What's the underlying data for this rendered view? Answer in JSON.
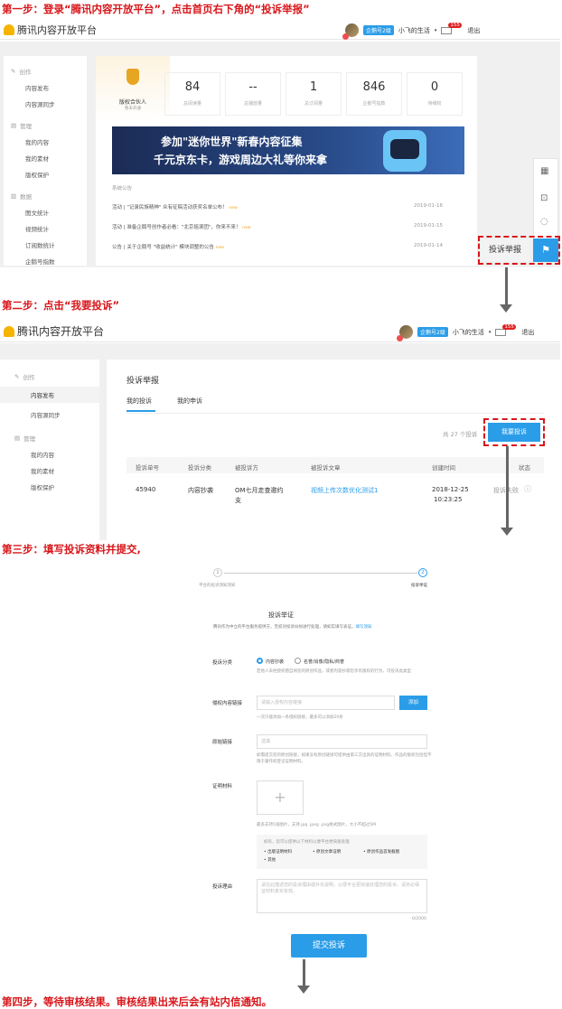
{
  "steps": {
    "step1": "第一步：登录“腾讯内容开放平台”，点击首页右下角的“投诉举报”",
    "step2": "第二步：点击“我要投诉”",
    "step3": "第三步：填写投诉资料并提交,",
    "step4": "第四步，等待审核结果。审核结果出来后会有站内信通知。"
  },
  "header": {
    "logo_text": "腾讯内容开放平台",
    "level_badge": "企鹅号2级",
    "username": "小飞的生活",
    "mail_count": "155",
    "logout": "退出"
  },
  "sidebar1": {
    "groups": [
      {
        "title": "创作",
        "items": [
          "内容发布",
          "内容源同步"
        ]
      },
      {
        "title": "管理",
        "items": [
          "我的内容",
          "我的素材",
          "版权保护"
        ]
      },
      {
        "title": "数据",
        "items": [
          "图文统计",
          "视频统计",
          "订阅数统计",
          "企鹅号指数"
        ]
      }
    ]
  },
  "dashboard": {
    "badge_title": "版权合伙人",
    "badge_sub": "暂未开通",
    "stats": [
      {
        "value": "84",
        "label": "总阅读量"
      },
      {
        "value": "--",
        "label": "总播放量"
      },
      {
        "value": "1",
        "label": "总订阅量"
      },
      {
        "value": "846",
        "label": "企鹅号指数"
      },
      {
        "value": "0",
        "label": "待维权"
      }
    ],
    "banner_line1": "参加\"迷你世界\"新春内容征集",
    "banner_line2": "千元京东卡，游戏周边大礼等你来拿",
    "notice_title": "系统公告",
    "notices": [
      {
        "text": "活动 | \"记录民族精神\" 众有征稿活动获奖名单公布！",
        "tag": "new",
        "date": "2019-01-16"
      },
      {
        "text": "活动 | 准备企鹅号创作者必看：\"北京摇滚团\"，你来不来！",
        "tag": "new",
        "date": "2019-01-15"
      },
      {
        "text": "公告 | 关于企鹅号 \"收益统计\" 模块调整的公告",
        "tag": "new",
        "date": "2019-01-14"
      }
    ],
    "report_label": "投诉举报"
  },
  "sidebar2": {
    "groups": [
      {
        "title": "创作",
        "items": [
          "内容发布",
          "内容源同步"
        ]
      },
      {
        "title": "管理",
        "items": [
          "我的内容",
          "我的素材",
          "版权保护"
        ]
      }
    ]
  },
  "report_page": {
    "title": "投诉举报",
    "tabs": [
      "我的投诉",
      "我的申诉"
    ],
    "total": "共 27 个投诉",
    "report_button": "我要投诉",
    "columns": [
      "投诉单号",
      "投诉分类",
      "被投诉方",
      "被投诉文章",
      "创建时间",
      "状态"
    ],
    "row": {
      "id": "45940",
      "category": "内容抄袭",
      "target_line1": "OM七月走查邀约",
      "target_line2": "支",
      "article": "视频上传次数优化测试1",
      "date": "2018-12-25",
      "time": "10:23:25",
      "status": "投诉失败"
    }
  },
  "form": {
    "step1_label": "平台的投诉须知须知",
    "step2_label": "投诉举证",
    "step1_num": "1",
    "step2_num": "2",
    "title": "投诉举证",
    "intro": "腾讯作为中立的平台服务提供方，无权对投诉纠纷进行处理，请如实填写表证。",
    "intro_link": "填写须知",
    "category_label": "投诉分类",
    "option1": "内容抄袭",
    "option2": "名誉/肖像/隐私/商誉",
    "category_hint": "若他人未经授权擅自将您的原创作品，或者内容抄袭您享有版权的行为，可投诉此类型",
    "link_label": "侵权内容链接",
    "link_placeholder": "请输入侵权内容链接",
    "add_button": "添加",
    "link_hint": "一次只能添加一条侵权链接，最多可以添加20条",
    "source_label": "原始链接",
    "source_placeholder": "选填",
    "source_hint": "如需提交您的原创链接，如果没有原创链接可提供由第三方出具的证明材料，作品的版权包括但不限于著作权登记证明材料。",
    "proof_label": "证明材料",
    "upload_hint": "最多支持5张图片，支持.jpg .jpeg .png格式图片，大小不超过5M",
    "proof_tip": "如有，您可以提供以下材料以便平台更快速处理",
    "proof_items": [
      "出版证明材料",
      "原创文章证明",
      "原创作品首发截图",
      "其他"
    ],
    "reason_label": "投诉理由",
    "reason_placeholder": "请在此描述您的投诉理由或补充说明，以便平台更快速处理您的投诉，请务必保证材料真实有效。",
    "counter": "0/2000",
    "submit": "提交投诉"
  },
  "colors": {
    "step_red": "#d8161b",
    "primary_blue": "#2b9de8",
    "arrow_gray": "#666666"
  }
}
